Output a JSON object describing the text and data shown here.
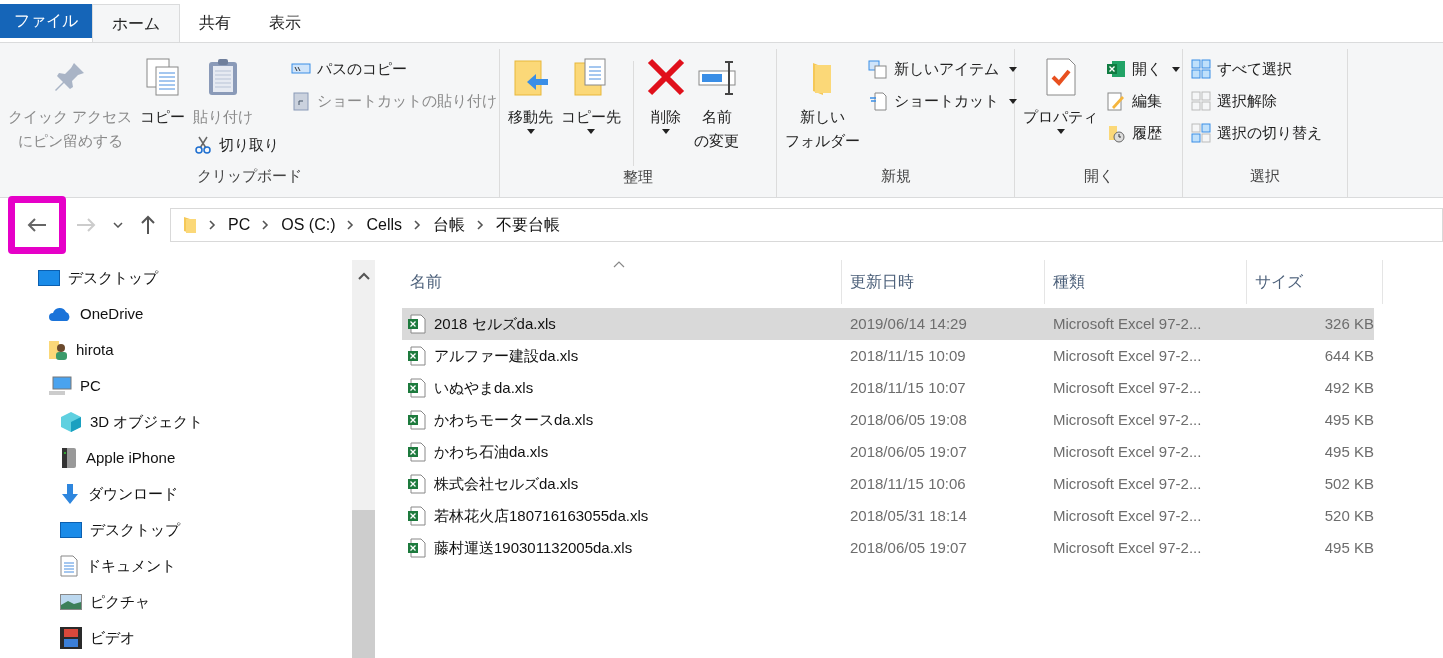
{
  "tabs": [
    {
      "kind": "file",
      "label": "ファイル",
      "selected": false
    },
    {
      "kind": "tab",
      "label": "ホーム",
      "selected": true
    },
    {
      "kind": "tab",
      "label": "共有",
      "selected": false
    },
    {
      "kind": "tab",
      "label": "表示",
      "selected": false
    }
  ],
  "ribbon": {
    "clipboard": {
      "label": "クリップボード",
      "pin": {
        "lines": [
          "クイック アクセス",
          "にピン留めする"
        ],
        "disabled": true
      },
      "copy": {
        "lines": [
          "コピー"
        ],
        "disabled": false
      },
      "paste": {
        "lines": [
          "貼り付け"
        ],
        "disabled": true
      },
      "cut": {
        "label": "切り取り",
        "disabled": false
      },
      "copy_path": {
        "label": "パスのコピー",
        "disabled": false
      },
      "paste_shortcut": {
        "label": "ショートカットの貼り付け",
        "disabled": true
      }
    },
    "organize": {
      "label": "整理",
      "move_to": {
        "lines": [
          "移動先"
        ],
        "dropdown": true
      },
      "copy_to": {
        "lines": [
          "コピー先"
        ],
        "dropdown": true
      },
      "delete": {
        "lines": [
          "削除"
        ],
        "dropdown": true
      },
      "rename": {
        "lines": [
          "名前",
          "の変更"
        ]
      }
    },
    "new": {
      "label": "新規",
      "new_folder": {
        "lines": [
          "新しい",
          "フォルダー"
        ]
      },
      "new_item": {
        "label": "新しいアイテム",
        "dropdown": true
      },
      "easy_access": {
        "label": "ショートカット",
        "dropdown": true
      }
    },
    "open": {
      "label": "開く",
      "properties": {
        "lines": [
          "プロパティ"
        ],
        "dropdown": true
      },
      "open": {
        "label": "開く",
        "dropdown": true
      },
      "edit": {
        "label": "編集"
      },
      "history": {
        "label": "履歴"
      }
    },
    "select": {
      "label": "選択",
      "select_all": {
        "label": "すべて選択"
      },
      "select_none": {
        "label": "選択解除"
      },
      "invert": {
        "label": "選択の切り替え"
      }
    }
  },
  "navigation": {
    "back": {
      "disabled": false,
      "highlighted": true
    },
    "forward": {
      "disabled": true
    },
    "path": [
      "PC",
      "OS (C:)",
      "Cells",
      "台帳",
      "不要台帳"
    ]
  },
  "sidebar": {
    "items": [
      {
        "kind": "desktop",
        "label": "デスクトップ",
        "children": [
          {
            "kind": "cloud",
            "label": "OneDrive"
          },
          {
            "kind": "user",
            "label": "hirota"
          },
          {
            "kind": "pc",
            "label": "PC",
            "children": [
              {
                "kind": "cube",
                "label": "3D オブジェクト"
              },
              {
                "kind": "device",
                "label": "Apple iPhone"
              },
              {
                "kind": "download",
                "label": "ダウンロード"
              },
              {
                "kind": "desktop",
                "label": "デスクトップ"
              },
              {
                "kind": "document",
                "label": "ドキュメント"
              },
              {
                "kind": "picture",
                "label": "ピクチャ"
              },
              {
                "kind": "video",
                "label": "ビデオ"
              }
            ]
          }
        ]
      }
    ]
  },
  "table": {
    "columns": [
      "名前",
      "更新日時",
      "種類",
      "サイズ"
    ],
    "rows": [
      {
        "name": "2018 セルズda.xls",
        "modified": "2019/06/14 14:29",
        "type": "Microsoft Excel 97-2...",
        "size": "326 KB",
        "selected": true
      },
      {
        "name": "アルファー建設da.xls",
        "modified": "2018/11/15 10:09",
        "type": "Microsoft Excel 97-2...",
        "size": "644 KB",
        "selected": false
      },
      {
        "name": "いぬやまda.xls",
        "modified": "2018/11/15 10:07",
        "type": "Microsoft Excel 97-2...",
        "size": "492 KB",
        "selected": false
      },
      {
        "name": "かわちモータースda.xls",
        "modified": "2018/06/05 19:08",
        "type": "Microsoft Excel 97-2...",
        "size": "495 KB",
        "selected": false
      },
      {
        "name": "かわち石油da.xls",
        "modified": "2018/06/05 19:07",
        "type": "Microsoft Excel 97-2...",
        "size": "495 KB",
        "selected": false
      },
      {
        "name": "株式会社セルズda.xls",
        "modified": "2018/11/15 10:06",
        "type": "Microsoft Excel 97-2...",
        "size": "502 KB",
        "selected": false
      },
      {
        "name": "若林花火店180716163055da.xls",
        "modified": "2018/05/31 18:14",
        "type": "Microsoft Excel 97-2...",
        "size": "520 KB",
        "selected": false
      },
      {
        "name": "藤村運送190301132005da.xls",
        "modified": "2018/06/05 19:07",
        "type": "Microsoft Excel 97-2...",
        "size": "495 KB",
        "selected": false
      }
    ]
  }
}
